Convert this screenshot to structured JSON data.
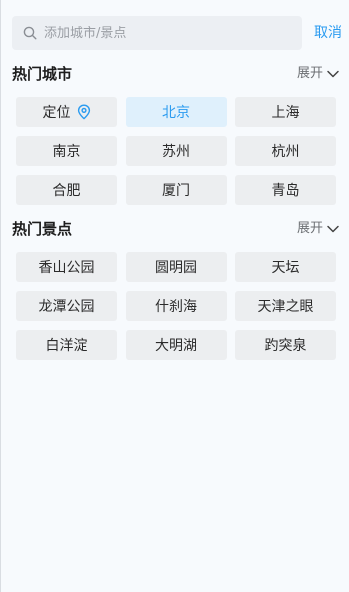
{
  "search": {
    "placeholder": "添加城市/景点",
    "value": "",
    "cancel_label": "取消"
  },
  "hot_cities": {
    "title": "热门城市",
    "expand_label": "展开",
    "locate_label": "定位",
    "selected_city": "北京",
    "items": [
      "北京",
      "上海",
      "南京",
      "苏州",
      "杭州",
      "合肥",
      "厦门",
      "青岛"
    ]
  },
  "hot_spots": {
    "title": "热门景点",
    "expand_label": "展开",
    "items": [
      "香山公园",
      "圆明园",
      "天坛",
      "龙潭公园",
      "什刹海",
      "天津之眼",
      "白洋淀",
      "大明湖",
      "趵突泉"
    ]
  },
  "colors": {
    "accent": "#2a9bf0",
    "selected_bg": "#dff0fc",
    "chip_bg": "#eceef0",
    "page_bg": "#f7fafd"
  },
  "icons": {
    "search": "search-icon",
    "location": "location-pin-icon",
    "chevron": "chevron-down-icon"
  }
}
